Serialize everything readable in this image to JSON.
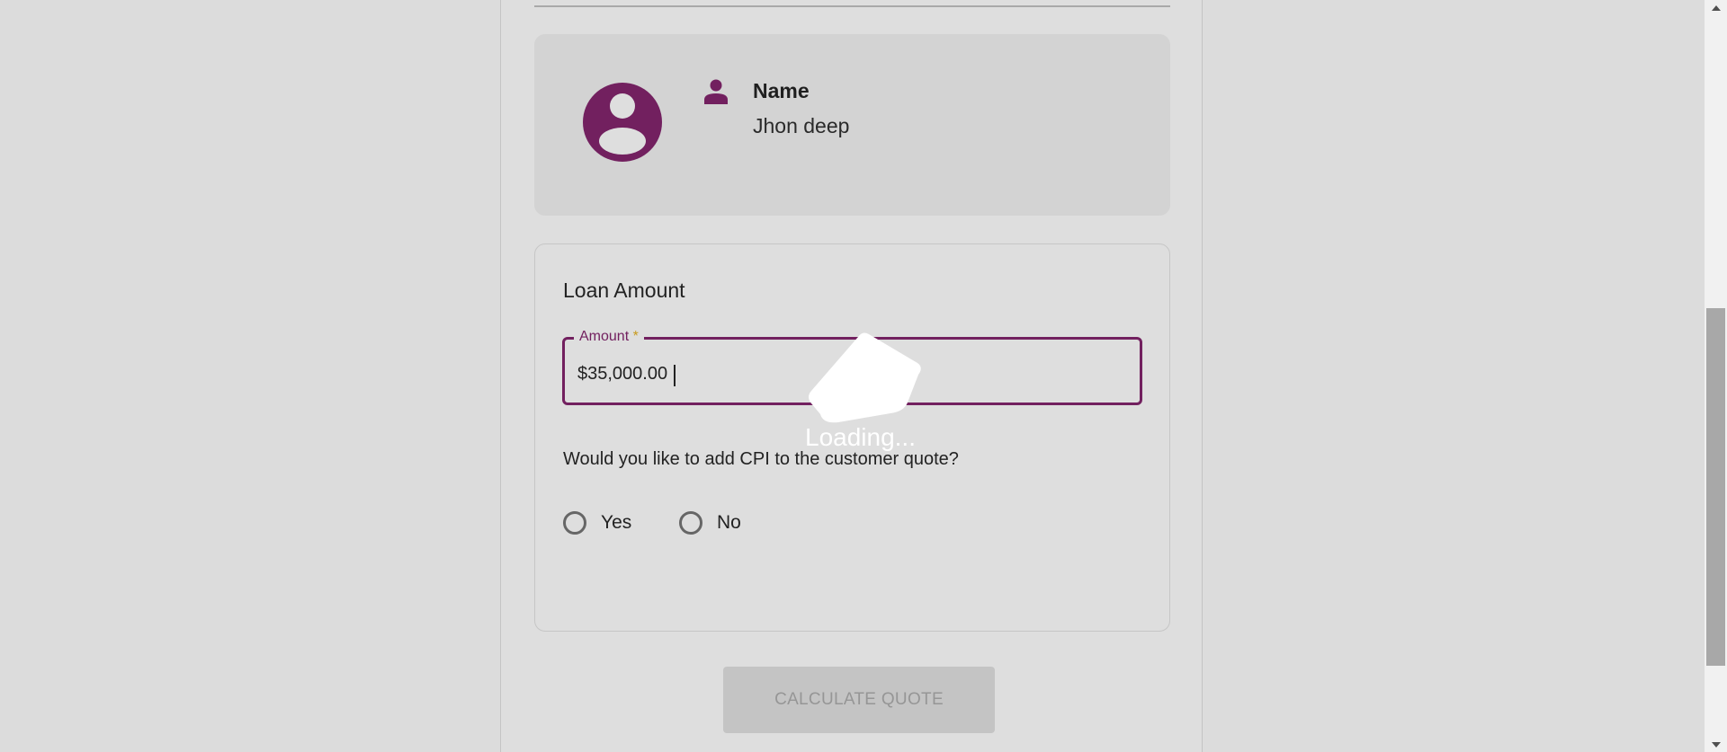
{
  "profile": {
    "name_label": "Name",
    "name_value": "Jhon deep"
  },
  "loan": {
    "title": "Loan Amount",
    "amount_label": "Amount",
    "required_marker": "*",
    "amount_value": "$35,000.00",
    "cpi_question": "Would you like to add CPI to the customer quote?",
    "options": [
      {
        "label": "Yes",
        "selected": false
      },
      {
        "label": "No",
        "selected": false
      }
    ]
  },
  "actions": {
    "calculate_label": "CALCULATE QUOTE",
    "calculate_disabled": true
  },
  "overlay": {
    "loading_text": "Loading..."
  },
  "colors": {
    "accent": "#72205f",
    "required": "#c79a1c",
    "background": "#dedede",
    "card": "#d3d3d3"
  },
  "icons": {
    "avatar": "account-circle-icon",
    "name": "person-icon",
    "scroll_up": "scroll-up-arrow-icon",
    "scroll_down": "scroll-down-arrow-icon"
  }
}
